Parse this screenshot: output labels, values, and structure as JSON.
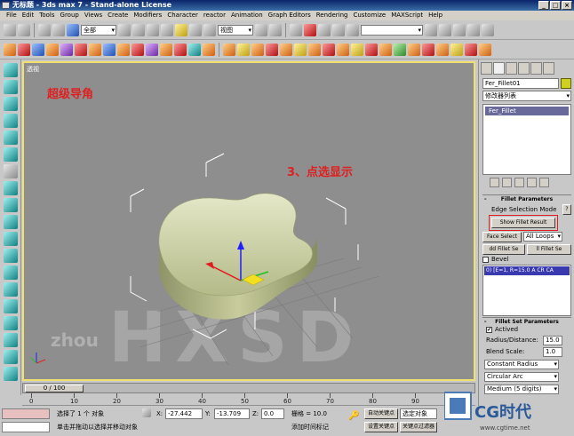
{
  "window": {
    "title": "无标题 - 3ds max 7 - Stand-alone License",
    "buttons": [
      "_",
      "□",
      "×"
    ]
  },
  "menu": [
    "File",
    "Edit",
    "Tools",
    "Group",
    "Views",
    "Create",
    "Modifiers",
    "Character",
    "reactor",
    "Animation",
    "Graph Editors",
    "Rendering",
    "Customize",
    "MAXScript",
    "Help"
  ],
  "toolbar": {
    "selection_filter": "全部",
    "ref_coord": "视图"
  },
  "viewport": {
    "label": "透视",
    "annotation_1": "超级导角",
    "annotation_2": "3、点选显示",
    "watermark": "HXSD",
    "watermark_small": "zhou"
  },
  "timeline": {
    "slider": "0 / 100",
    "ticks": [
      "0",
      "10",
      "20",
      "30",
      "40",
      "50",
      "60",
      "70",
      "80",
      "90",
      "100"
    ]
  },
  "status": {
    "selection": "选择了 1 个 对象",
    "prompt": "单击并拖动以选择并移动对象",
    "x_label": "X:",
    "x_value": "-27.442",
    "y_label": "Y:",
    "y_value": "-13.709",
    "z_label": "Z:",
    "z_value": "0.0",
    "grid_label": "栅格 = 10.0",
    "add_time_tag": "添加时间标记",
    "auto_key": "自动关键点",
    "set_key": "设置关键点",
    "selected": "选定对象",
    "key_filter": "关键点过滤器"
  },
  "command_panel": {
    "object_name": "Fer_Fillet01",
    "modifier_list": "修改器列表",
    "stack_item": "Fer_Fillet",
    "swatch_color": "#d0d020",
    "fillet_params": {
      "header": "Fillet Parameters",
      "edge_selection_mode": "Edge Selection Mode",
      "help": "?",
      "show_fillet_result": "Show Fillet Result",
      "face_select": "Face Select",
      "loops": "All Loops",
      "add_fillet_set": "dd Fillet Se",
      "kill_fillet_set": "ll Fillet Se",
      "bevel_label": "Bevel",
      "fillet_item": "0) [E=1, R=15.0 A CR CA"
    },
    "fillet_set_params": {
      "header": "Fillet Set Parameters",
      "actived_label": "Actived",
      "actived_check": "✔",
      "radius_label": "Radius/Distance:",
      "radius_value": "15.0",
      "blend_label": "Blend Scale:",
      "blend_value": "1.0",
      "mode": "Constant Radius",
      "arc": "Circular Arc",
      "precision": "Medium (5 digits)"
    }
  },
  "logo": {
    "text": "CG时代",
    "url": "www.cgtime.net"
  }
}
